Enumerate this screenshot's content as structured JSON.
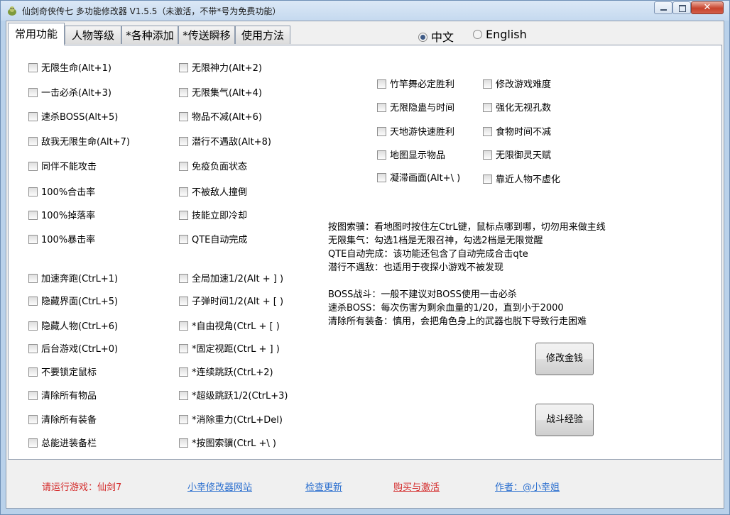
{
  "window": {
    "title": "仙剑奇侠传七 多功能修改器 V1.5.5（未激活，不带*号为免费功能）",
    "close_glyph": "✕"
  },
  "tabs": [
    "常用功能",
    "人物等级",
    "*各种添加",
    "*传送瞬移",
    "使用方法"
  ],
  "language": {
    "options": [
      "中文",
      "English"
    ],
    "selected": "中文"
  },
  "options_col1": [
    "无限生命(Alt+1)",
    "一击必杀(Alt+3)",
    "速杀BOSS(Alt+5)",
    "敌我无限生命(Alt+7)",
    "同伴不能攻击",
    "100%合击率",
    "100%掉落率",
    "100%暴击率",
    "加速奔跑(CtrL+1)",
    "隐藏界面(CtrL+5)",
    "隐藏人物(CtrL+6)",
    "后台游戏(CtrL+0)",
    "不要锁定鼠标",
    "清除所有物品",
    "清除所有装备",
    "总能进装备栏"
  ],
  "options_col2": [
    "无限神力(Alt+2)",
    "无限集气(Alt+4)",
    "物品不减(Alt+6)",
    "潜行不遇敌(Alt+8)",
    "免疫负面状态",
    "不被敌人撞倒",
    "技能立即冷却",
    "QTE自动完成",
    "全局加速1/2(Alt + ] )",
    "子弹时间1/2(Alt + [ )",
    "*自由视角(CtrL + [ )",
    "*固定视距(CtrL + ] )",
    "*连续跳跃(CtrL+2)",
    "*超级跳跃1/2(CtrL+3)",
    "*消除重力(CtrL+Del)",
    "*按图索骥(CtrL +\\ )"
  ],
  "options_col3": [
    "竹竿舞必定胜利",
    "无限隐蛊与时间",
    "天地游快速胜利",
    "地图显示物品",
    "凝滞画面(Alt+\\ )"
  ],
  "options_col4": [
    "修改游戏难度",
    "强化无视孔数",
    "食物时间不减",
    "无限御灵天赋",
    "靠近人物不虚化"
  ],
  "notes": [
    "按图索骥：看地图时按住左CtrL键，鼠标点哪到哪，切勿用来做主线",
    "无限集气：勾选1档是无限召神，勾选2档是无限觉醒",
    "QTE自动完成：该功能还包含了自动完成合击qte",
    "潜行不遇敌：也适用于夜探小游戏不被发现",
    "",
    "BOSS战斗：一般不建议对BOSS使用一击必杀",
    "速杀BOSS：每次伤害为剩余血量的1/20，直到小于2000",
    "清除所有装备：慎用，会把角色身上的武器也脱下导致行走困难"
  ],
  "buttons": {
    "money": "修改金钱",
    "exp": "战斗经验"
  },
  "footer": {
    "run_game": "请运行游戏：仙剑7",
    "site": "小幸修改器网站",
    "update": "检查更新",
    "buy": "购买与激活",
    "author": "作者：@小幸姐"
  },
  "colors": {
    "link_blue": "#2b6fcf",
    "red": "#d42a2a",
    "selected_radio": "#3e5a86"
  }
}
